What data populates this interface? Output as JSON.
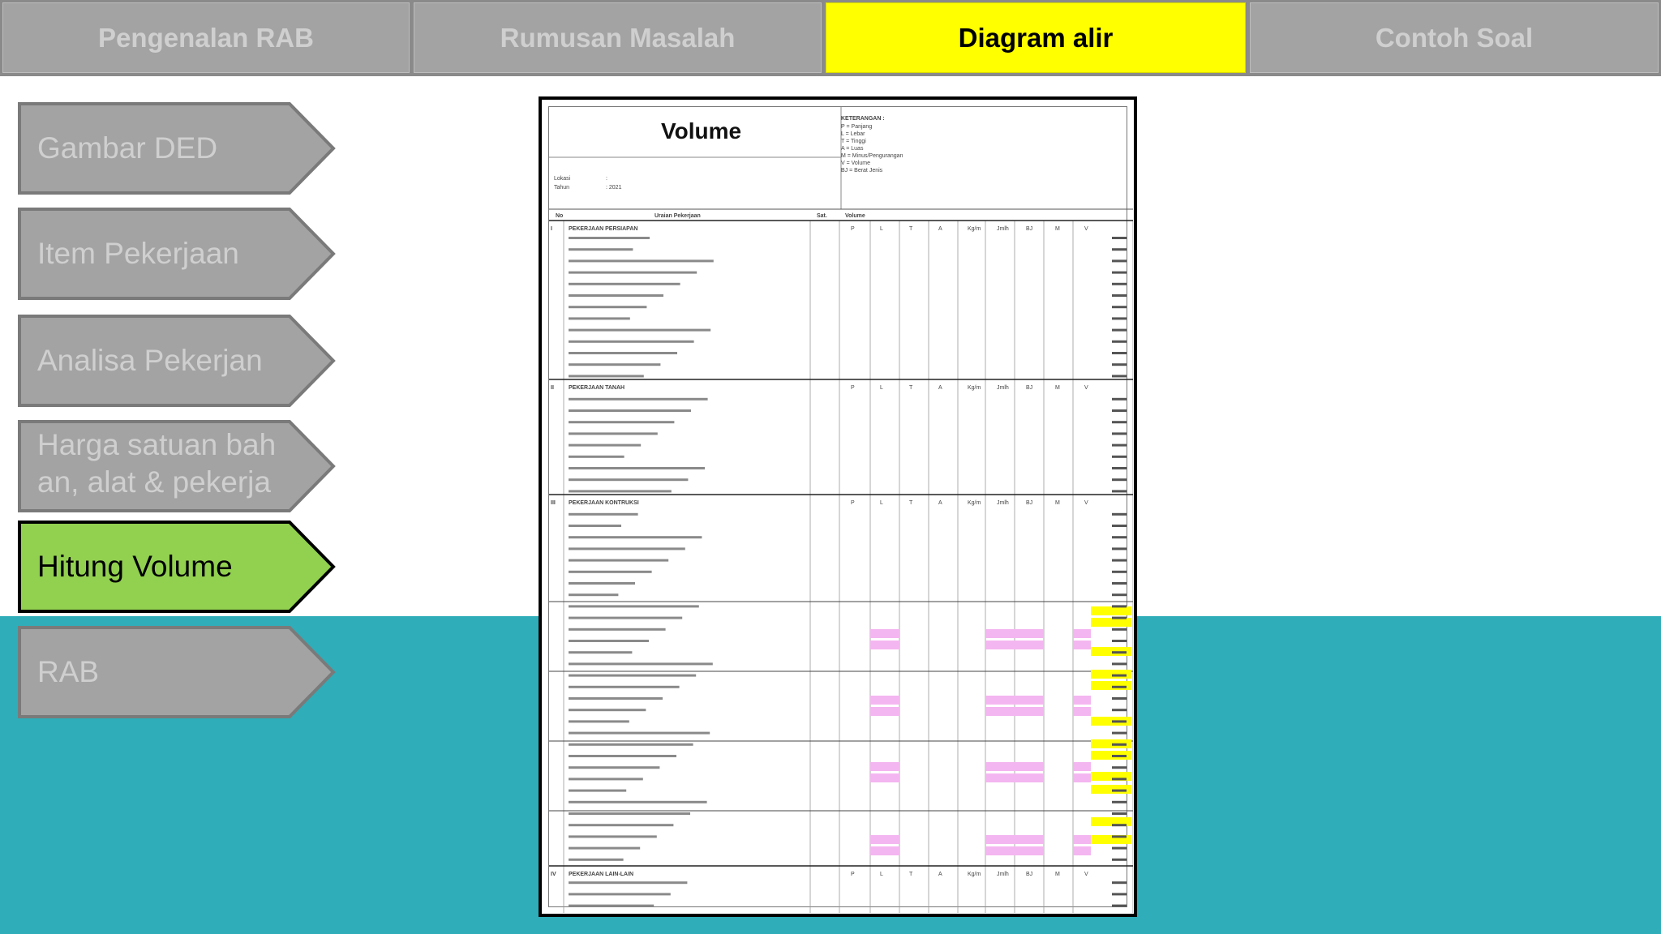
{
  "tabs": [
    {
      "label": "Pengenalan RAB",
      "active": false
    },
    {
      "label": "Rumusan Masalah",
      "active": false
    },
    {
      "label": "Diagram alir",
      "active": true
    },
    {
      "label": "Contoh Soal",
      "active": false
    }
  ],
  "sidebar": [
    {
      "label": "Gambar DED",
      "active": false
    },
    {
      "label": "Item Pekerjaan",
      "active": false
    },
    {
      "label": "Analisa Pekerjan",
      "active": false
    },
    {
      "label": "Harga satuan bah an, alat & pekerja",
      "active": false
    },
    {
      "label": "Hitung Volume",
      "active": true
    },
    {
      "label": "RAB",
      "active": false
    }
  ],
  "colors": {
    "active_tab": "#ffff00",
    "active_side": "#92d050",
    "inactive": "#a3a3a3",
    "inactive_text": "#cfcfcf",
    "teal": "#2fadb8",
    "highlight_yellow": "#ffff00",
    "highlight_pink": "#f4b6f0"
  },
  "document": {
    "title": "Volume",
    "legend_header": "KETERANGAN :",
    "legend_items": [
      "P = Panjang",
      "L = Lebar",
      "T = Tinggi",
      "A = Luas",
      "M = Minus/Pengurangan",
      "V = Volume",
      "BJ = Berat Jenis"
    ],
    "lokasi_label": "Lokasi",
    "lokasi_value": ":",
    "tahun_label": "Tahun",
    "tahun_value": ": 2021",
    "columns": [
      "No",
      "Uraian Pekerjaan",
      "Sat.",
      "Volume"
    ],
    "subcolumns": [
      "P",
      "L",
      "T",
      "A",
      "Kg/m",
      "Jmlh",
      "BJ",
      "M",
      "V"
    ],
    "sections": [
      {
        "code": "I",
        "title": "PEKERJAAN PERSIAPAN"
      },
      {
        "code": "II",
        "title": "PEKERJAAN TANAH"
      },
      {
        "code": "III",
        "title": "PEKERJAAN KONTRUKSI"
      },
      {
        "code": "IV",
        "title": "PEKERJAAN LAIN-LAIN"
      }
    ]
  }
}
